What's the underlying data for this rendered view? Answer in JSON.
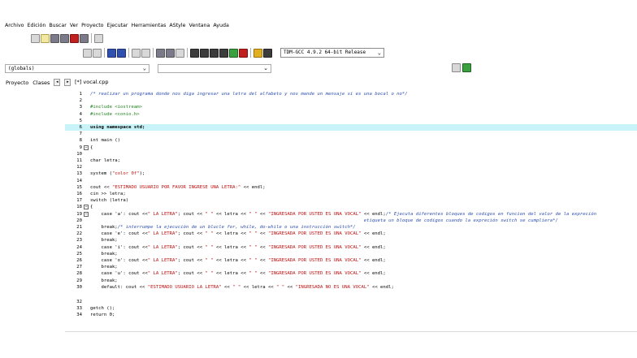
{
  "menubar": [
    "Archivo",
    "Edición",
    "Buscar",
    "Ver",
    "Proyecto",
    "Ejecutar",
    "Herramientas",
    "AStyle",
    "Ventana",
    "Ayuda"
  ],
  "toolbar": {
    "compiler": "TDM-GCC 4.9.2 64-bit Release"
  },
  "scope": {
    "globals": "(globals)",
    "second": ""
  },
  "panel": {
    "tab_proyecto": "Proyecto",
    "tab_clases": "Clases",
    "prev": "◂",
    "next": "▸"
  },
  "file_tab": "[*] vocal.cpp",
  "code_lines": [
    {
      "n": "1",
      "text": "/* realizar un programa donde nos diga ingresar una letra del alfabeto y nos mande un mensaje si es una bocal o no*/",
      "kind": "comment"
    },
    {
      "n": "2",
      "text": "",
      "kind": "plain"
    },
    {
      "n": "3",
      "text": "#include <iostream>",
      "kind": "pre"
    },
    {
      "n": "4",
      "text": "#include <conio.h>",
      "kind": "pre"
    },
    {
      "n": "5",
      "text": "",
      "kind": "plain"
    },
    {
      "n": "6",
      "text": "using namespace std;",
      "kind": "kw",
      "current": true
    },
    {
      "n": "7",
      "text": "",
      "kind": "plain"
    },
    {
      "n": "8",
      "text": "int main ()",
      "kind": "plain"
    },
    {
      "n": "9",
      "text": "{",
      "kind": "plain",
      "fold": true
    },
    {
      "n": "10",
      "text": "",
      "kind": "plain"
    },
    {
      "n": "11",
      "text": "char letra;",
      "kind": "plain"
    },
    {
      "n": "12",
      "text": "",
      "kind": "plain"
    },
    {
      "n": "13",
      "text": "system (\"color 0f\");",
      "kind": "mixed",
      "parts": [
        [
          "system (",
          ""
        ],
        [
          "\"color 0f\"",
          "st"
        ],
        [
          ");",
          ""
        ]
      ]
    },
    {
      "n": "14",
      "text": "",
      "kind": "plain"
    },
    {
      "n": "15",
      "text": "cout << \"ESTIMADO USUARIO POR FAVOR INGRESE UNA LETRA:\" << endl;",
      "kind": "mixed",
      "parts": [
        [
          "cout << ",
          ""
        ],
        [
          "\"ESTIMADO USUARIO POR FAVOR INGRESE UNA LETRA:\"",
          "st"
        ],
        [
          " << endl;",
          ""
        ]
      ]
    },
    {
      "n": "16",
      "text": "cin >> letra;",
      "kind": "plain"
    },
    {
      "n": "17",
      "text": "switch (letra)",
      "kind": "plain"
    },
    {
      "n": "18",
      "text": "{",
      "kind": "plain",
      "fold": true
    },
    {
      "n": "19",
      "text": "    case 'a': cout <<\" LA LETRA\"; cout << \" \" << letra << \" \" << \"INGRESADA POR USTED ES UNA VOCAL\" << endl;/* Ejecuta diferentes bloques de codigos en funcion del valor de la expreción",
      "kind": "mixed",
      "fold": true,
      "parts": [
        [
          "    case 'a': cout <<",
          ""
        ],
        [
          "\" LA LETRA\"",
          "st"
        ],
        [
          "; cout << ",
          ""
        ],
        [
          "\" \"",
          "st"
        ],
        [
          " << letra << ",
          ""
        ],
        [
          "\" \"",
          "st"
        ],
        [
          " << ",
          ""
        ],
        [
          "\"INGRESADA POR USTED ES UNA VOCAL\"",
          "st"
        ],
        [
          " << endl;",
          ""
        ],
        [
          "/* Ejecuta diferentes bloques de codigos en funcion del valor de la expreción",
          "cm"
        ]
      ]
    },
    {
      "n": "20",
      "text": "                                                                                                    etiqueta un bloque de codigos cuando la expreción switch se cumpliera*/",
      "kind": "comment"
    },
    {
      "n": "21",
      "text": "    break;/* interrumpe la ejecución de un blucle for, while, do-while o una instrucción switch*/",
      "kind": "mixed",
      "parts": [
        [
          "    break;",
          ""
        ],
        [
          "/* interrumpe la ejecución de un blucle for, while, do-while o una instrucción switch*/",
          "cm"
        ]
      ]
    },
    {
      "n": "22",
      "text": "    case 'e': cout <<\" LA LETRA\"; cout << \" \" << letra << \" \" << \"INGRESADA POR USTED ES UNA VOCAL\" << endl;",
      "kind": "mixed",
      "parts": [
        [
          "    case 'e': cout <<",
          ""
        ],
        [
          "\" LA LETRA\"",
          "st"
        ],
        [
          "; cout << ",
          ""
        ],
        [
          "\" \"",
          "st"
        ],
        [
          " << letra << ",
          ""
        ],
        [
          "\" \"",
          "st"
        ],
        [
          " << ",
          ""
        ],
        [
          "\"INGRESADA POR USTED ES UNA VOCAL\"",
          "st"
        ],
        [
          " << endl;",
          ""
        ]
      ]
    },
    {
      "n": "23",
      "text": "    break;",
      "kind": "plain"
    },
    {
      "n": "24",
      "text": "    case 'i': cout <<\" LA LETRA\"; cout << \" \" << letra << \" \" << \"INGRESADA POR USTED ES UNA VOCAL\" << endl;",
      "kind": "mixed",
      "parts": [
        [
          "    case 'i': cout <<",
          ""
        ],
        [
          "\" LA LETRA\"",
          "st"
        ],
        [
          "; cout << ",
          ""
        ],
        [
          "\" \"",
          "st"
        ],
        [
          " << letra << ",
          ""
        ],
        [
          "\" \"",
          "st"
        ],
        [
          " << ",
          ""
        ],
        [
          "\"INGRESADA POR USTED ES UNA VOCAL\"",
          "st"
        ],
        [
          " << endl;",
          ""
        ]
      ]
    },
    {
      "n": "25",
      "text": "    break;",
      "kind": "plain"
    },
    {
      "n": "26",
      "text": "    case 'o': cout <<\" LA LETRA\"; cout << \" \" << letra << \" \" << \"INGRESADA POR USTED ES UNA VOCAL\" << endl;",
      "kind": "mixed",
      "parts": [
        [
          "    case 'o': cout <<",
          ""
        ],
        [
          "\" LA LETRA\"",
          "st"
        ],
        [
          "; cout << ",
          ""
        ],
        [
          "\" \"",
          "st"
        ],
        [
          " << letra << ",
          ""
        ],
        [
          "\" \"",
          "st"
        ],
        [
          " << ",
          ""
        ],
        [
          "\"INGRESADA POR USTED ES UNA VOCAL\"",
          "st"
        ],
        [
          " << endl;",
          ""
        ]
      ]
    },
    {
      "n": "27",
      "text": "    break;",
      "kind": "plain"
    },
    {
      "n": "28",
      "text": "    case 'u': cout <<\" LA LETRA\"; cout << \" \" << letra << \" \" << \"INGRESADA POR USTED ES UNA VOCAL\" << endl;",
      "kind": "mixed",
      "parts": [
        [
          "    case 'u': cout <<",
          ""
        ],
        [
          "\" LA LETRA\"",
          "st"
        ],
        [
          "; cout << ",
          ""
        ],
        [
          "\" \"",
          "st"
        ],
        [
          " << letra << ",
          ""
        ],
        [
          "\" \"",
          "st"
        ],
        [
          " << ",
          ""
        ],
        [
          "\"INGRESADA POR USTED ES UNA VOCAL\"",
          "st"
        ],
        [
          " << endl;",
          ""
        ]
      ]
    },
    {
      "n": "29",
      "text": "    break;",
      "kind": "plain"
    },
    {
      "n": "30",
      "text": "    default: cout << \"ESTIMADO USUARIO LA LETRA\" << \" \" << letra << \" \" << \"INGRESADA NO ES UNA VOCAL\" << endl;",
      "kind": "mixed",
      "parts": [
        [
          "    default: cout << ",
          ""
        ],
        [
          "\"ESTIMADO USUARIO LA LETRA\"",
          "st"
        ],
        [
          " << ",
          ""
        ],
        [
          "\" \"",
          "st"
        ],
        [
          " << letra << ",
          ""
        ],
        [
          "\" \"",
          "st"
        ],
        [
          " << ",
          ""
        ],
        [
          "\"INGRESADA NO ES UNA VOCAL\"",
          "st"
        ],
        [
          " << endl;",
          ""
        ]
      ]
    },
    {
      "n": "32",
      "text": "",
      "kind": "plain",
      "gapBefore": true
    },
    {
      "n": "33",
      "text": "getch ();",
      "kind": "plain"
    },
    {
      "n": "34",
      "text": "return 0;",
      "kind": "plain"
    }
  ],
  "colors": {
    "comment": "#3050b0",
    "string": "#c01010",
    "preprocessor": "#208020",
    "current_line": "#c8f3f8"
  }
}
